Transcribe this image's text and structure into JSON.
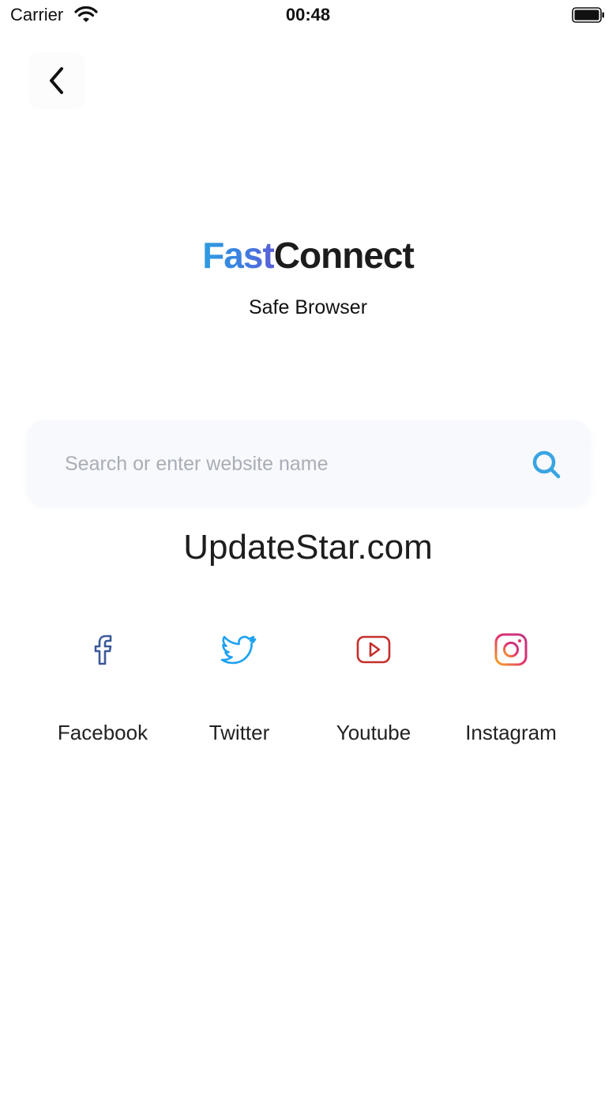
{
  "status_bar": {
    "carrier": "Carrier",
    "time": "00:48"
  },
  "header": {
    "back_icon": "chevron-left-icon"
  },
  "brand": {
    "name_part1": "Fast",
    "name_part2": "Connect",
    "tagline": "Safe Browser",
    "gradient_colors": [
      "#2c9de0",
      "#5a5fd8"
    ]
  },
  "search": {
    "value": "",
    "placeholder": "Search or enter website name",
    "icon": "search-icon",
    "icon_color": "#3aa4e2"
  },
  "site": {
    "name": "UpdateStar.com"
  },
  "shortcuts": [
    {
      "label": "Facebook",
      "icon": "facebook-icon",
      "color": "#3b5998"
    },
    {
      "label": "Twitter",
      "icon": "twitter-icon",
      "color": "#1da1f2"
    },
    {
      "label": "Youtube",
      "icon": "youtube-icon",
      "color": "#c4302b"
    },
    {
      "label": "Instagram",
      "icon": "instagram-icon",
      "color": "#e1306c"
    }
  ]
}
